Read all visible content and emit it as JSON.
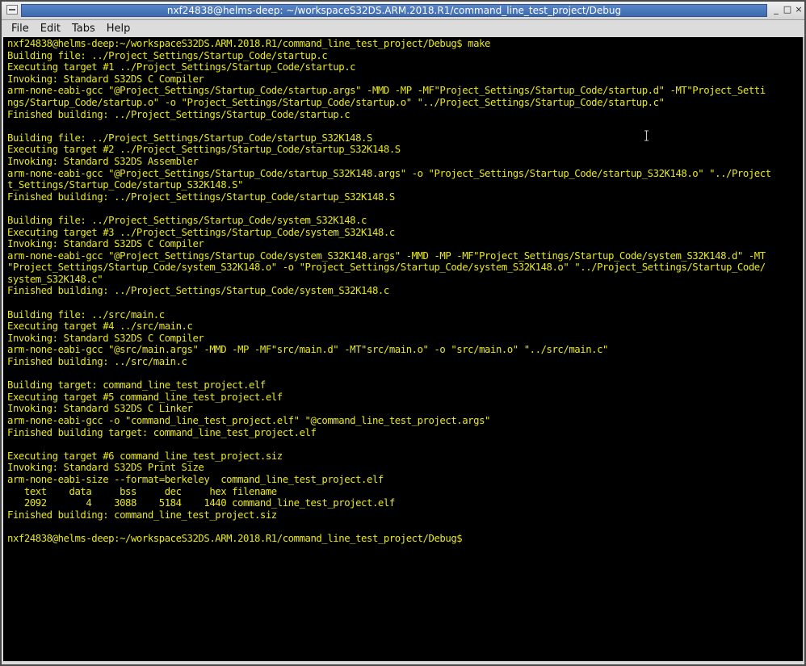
{
  "window": {
    "title": "nxf24838@helms-deep: ~/workspaceS32DS.ARM.2018.R1/command_line_test_project/Debug",
    "minimize_glyph": "_",
    "maximize_glyph": "□",
    "close_glyph": "×"
  },
  "menu": {
    "items": [
      "File",
      "Edit",
      "Tabs",
      "Help"
    ]
  },
  "terminal": {
    "foreground": "#e8e81d",
    "background": "#000000",
    "lines": [
      "nxf24838@helms-deep:~/workspaceS32DS.ARM.2018.R1/command_line_test_project/Debug$ make",
      "Building file: ../Project_Settings/Startup_Code/startup.c",
      "Executing target #1 ../Project_Settings/Startup_Code/startup.c",
      "Invoking: Standard S32DS C Compiler",
      "arm-none-eabi-gcc \"@Project_Settings/Startup_Code/startup.args\" -MMD -MP -MF\"Project_Settings/Startup_Code/startup.d\" -MT\"Project_Setti",
      "ngs/Startup_Code/startup.o\" -o \"Project_Settings/Startup_Code/startup.o\" \"../Project_Settings/Startup_Code/startup.c\"",
      "Finished building: ../Project_Settings/Startup_Code/startup.c",
      "",
      "Building file: ../Project_Settings/Startup_Code/startup_S32K148.S",
      "Executing target #2 ../Project_Settings/Startup_Code/startup_S32K148.S",
      "Invoking: Standard S32DS Assembler",
      "arm-none-eabi-gcc \"@Project_Settings/Startup_Code/startup_S32K148.args\" -o \"Project_Settings/Startup_Code/startup_S32K148.o\" \"../Project",
      "t_Settings/Startup_Code/startup_S32K148.S\"",
      "Finished building: ../Project_Settings/Startup_Code/startup_S32K148.S",
      "",
      "Building file: ../Project_Settings/Startup_Code/system_S32K148.c",
      "Executing target #3 ../Project_Settings/Startup_Code/system_S32K148.c",
      "Invoking: Standard S32DS C Compiler",
      "arm-none-eabi-gcc \"@Project_Settings/Startup_Code/system_S32K148.args\" -MMD -MP -MF\"Project_Settings/Startup_Code/system_S32K148.d\" -MT",
      "\"Project_Settings/Startup_Code/system_S32K148.o\" -o \"Project_Settings/Startup_Code/system_S32K148.o\" \"../Project_Settings/Startup_Code/",
      "system_S32K148.c\"",
      "Finished building: ../Project_Settings/Startup_Code/system_S32K148.c",
      "",
      "Building file: ../src/main.c",
      "Executing target #4 ../src/main.c",
      "Invoking: Standard S32DS C Compiler",
      "arm-none-eabi-gcc \"@src/main.args\" -MMD -MP -MF\"src/main.d\" -MT\"src/main.o\" -o \"src/main.o\" \"../src/main.c\"",
      "Finished building: ../src/main.c",
      "",
      "Building target: command_line_test_project.elf",
      "Executing target #5 command_line_test_project.elf",
      "Invoking: Standard S32DS C Linker",
      "arm-none-eabi-gcc -o \"command_line_test_project.elf\" \"@command_line_test_project.args\"",
      "Finished building target: command_line_test_project.elf",
      "",
      "Executing target #6 command_line_test_project.siz",
      "Invoking: Standard S32DS Print Size",
      "arm-none-eabi-size --format=berkeley  command_line_test_project.elf",
      "   text    data     bss     dec     hex filename",
      "   2092       4    3088    5184    1440 command_line_test_project.elf",
      "Finished building: command_line_test_project.siz",
      "",
      "nxf24838@helms-deep:~/workspaceS32DS.ARM.2018.R1/command_line_test_project/Debug$"
    ]
  }
}
